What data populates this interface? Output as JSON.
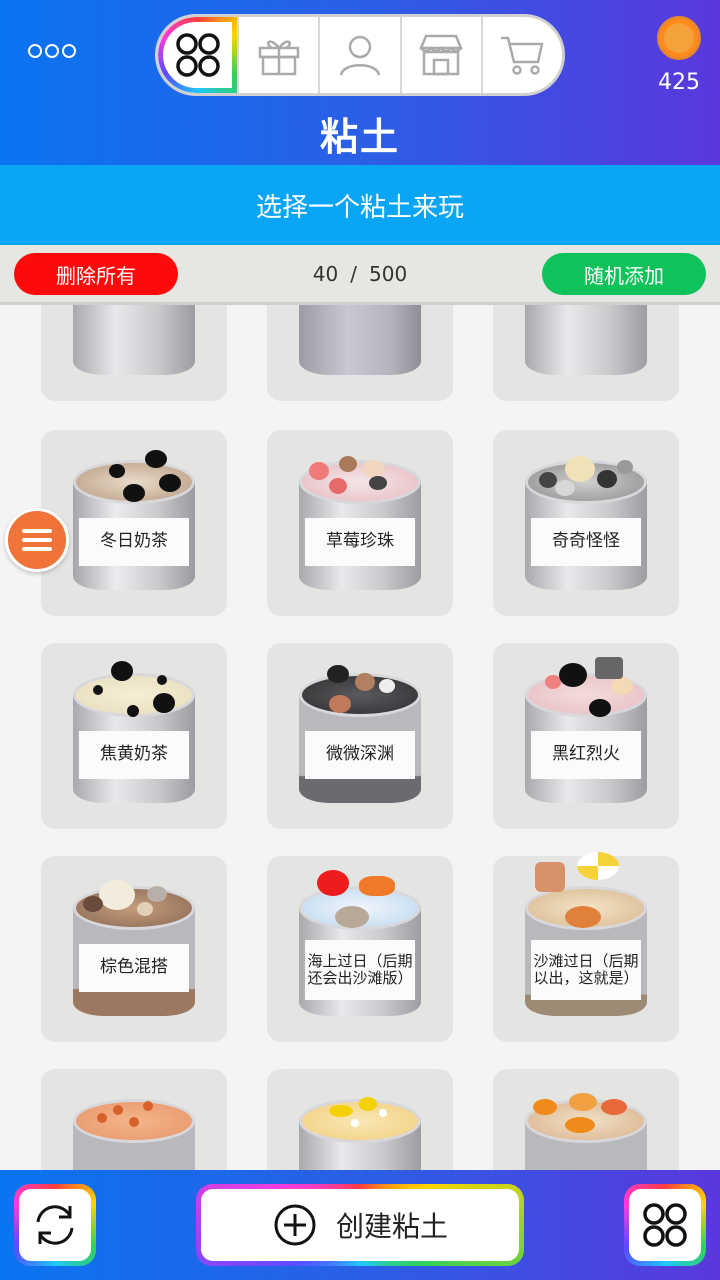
{
  "header": {
    "title": "粘土",
    "coins": "425",
    "tabs": [
      {
        "icon": "grid-icon",
        "active": true
      },
      {
        "icon": "gift-icon",
        "active": false
      },
      {
        "icon": "person-icon",
        "active": false
      },
      {
        "icon": "shop-icon",
        "active": false
      },
      {
        "icon": "cart-icon",
        "active": false
      }
    ]
  },
  "subtitle": "选择一个粘土来玩",
  "actions": {
    "delete_all": "删除所有",
    "count": "40",
    "separator": "/",
    "max": "500",
    "random_add": "随机添加"
  },
  "items": [
    {
      "label": ""
    },
    {
      "label": ""
    },
    {
      "label": ""
    },
    {
      "label": "冬日奶茶"
    },
    {
      "label": "草莓珍珠"
    },
    {
      "label": "奇奇怪怪"
    },
    {
      "label": "焦黄奶茶"
    },
    {
      "label": "微微深渊"
    },
    {
      "label": "黑红烈火"
    },
    {
      "label": "棕色混搭"
    },
    {
      "label": "海上过日（后期还会出沙滩版）"
    },
    {
      "label": "沙滩过日（后期以出，这就是）"
    },
    {
      "label": ""
    },
    {
      "label": ""
    },
    {
      "label": ""
    }
  ],
  "bottom": {
    "create_label": "创建粘土"
  },
  "colors": {
    "header_start": "#0a74f0",
    "header_end": "#5a38dc",
    "subtitle_bg": "#0aa5f5",
    "delete_btn": "#ff0a0a",
    "random_btn": "#0fc35a",
    "side_menu": "#f0733a"
  }
}
